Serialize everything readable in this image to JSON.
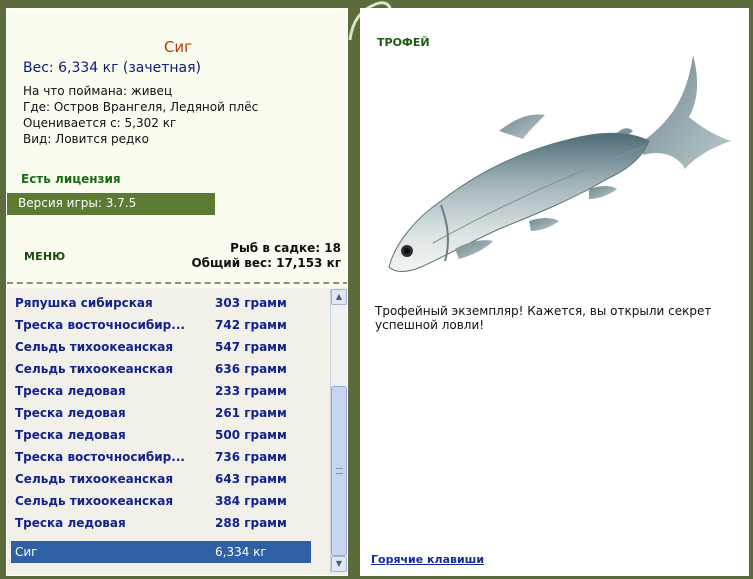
{
  "fish": {
    "name": "Сиг",
    "weight": "Вес: 6,334 кг (зачетная)",
    "bait": "На что поймана: живец",
    "location": "Где: Остров Врангеля, Ледяной плёс",
    "valued": "Оценивается с: 5,302 кг",
    "kind": "Вид: Ловится редко"
  },
  "license": "Есть лицензия",
  "version": "Версия игры: 3.7.5",
  "menu_label": "МЕНЮ",
  "cage": {
    "count": "Рыб в садке: 18",
    "total": "Общий вес: 17,153 кг"
  },
  "catch_list": [
    {
      "name": "Ряпушка сибирская",
      "weight": "303 грамм"
    },
    {
      "name": "Треска восточносибир...",
      "weight": "742 грамм"
    },
    {
      "name": "Сельдь тихоокеанская",
      "weight": "547 грамм"
    },
    {
      "name": "Сельдь тихоокеанская",
      "weight": "636 грамм"
    },
    {
      "name": "Треска ледовая",
      "weight": "233 грамм"
    },
    {
      "name": "Треска ледовая",
      "weight": "261 грамм"
    },
    {
      "name": "Треска ледовая",
      "weight": "500 грамм"
    },
    {
      "name": "Треска восточносибир...",
      "weight": "736 грамм"
    },
    {
      "name": "Сельдь тихоокеанская",
      "weight": "643 грамм"
    },
    {
      "name": "Сельдь тихоокеанская",
      "weight": "384 грамм"
    },
    {
      "name": "Треска ледовая",
      "weight": "288 грамм"
    },
    {
      "name": "Сиг",
      "weight": "6,334 кг",
      "selected": true
    }
  ],
  "trophy": {
    "label": "ТРОФЕЙ",
    "message": "Трофейный экземпляр! Кажется, вы открыли секрет успешной ловли!"
  },
  "hotkeys": "Горячие клавиши",
  "colors": {
    "background": "#5c6b3c",
    "panel": "#fbfcf0",
    "accent_green": "#5c7a32",
    "fish_name": "#b83c08",
    "list_text": "#14228a",
    "selection": "#2f5fa4"
  },
  "icons": [
    "scroll-up-icon",
    "scroll-down-icon",
    "ornament-icon"
  ]
}
